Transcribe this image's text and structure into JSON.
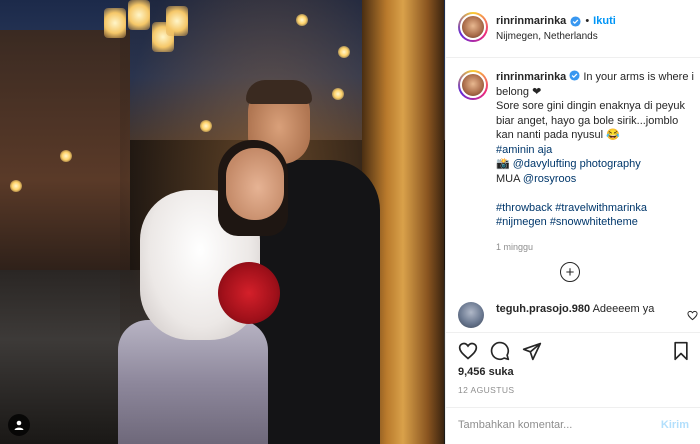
{
  "post": {
    "username": "rinrinmarinka",
    "follow_label": "Ikuti",
    "separator": "•",
    "location": "Nijmegen, Netherlands",
    "caption_lines": [
      "In your arms is where i belong ❤",
      "Sore sore gini dingin enaknya di peyuk biar anget, hayo ga bole sirik...jomblo kan nanti pada nyusul 😂"
    ],
    "caption_tag_1": "#aminin aja",
    "caption_credit_icon": "📸",
    "caption_credit": "@davylufting photography",
    "caption_mua_label": "MUA",
    "caption_mua": "@rosyroos",
    "caption_tags_line1": "#throwback #travelwithmarinka",
    "caption_tags_line2": "#nijmegen #snowwhitetheme",
    "time_ago": "1 minggu"
  },
  "comment": {
    "username": "teguh.prasojo.980",
    "text": "Adeeeem ya"
  },
  "actions": {
    "likes": "9,456 suka",
    "date": "12 AGUSTUS",
    "comment_placeholder": "Tambahkan komentar...",
    "post_label": "Kirim"
  },
  "colors": {
    "link": "#0095f6",
    "hashtag": "#00376b",
    "muted": "#8e8e8e"
  },
  "icons": [
    "verified-icon",
    "heart-icon",
    "comment-icon",
    "share-icon",
    "bookmark-icon",
    "plus-circle-icon",
    "user-tag-icon"
  ]
}
